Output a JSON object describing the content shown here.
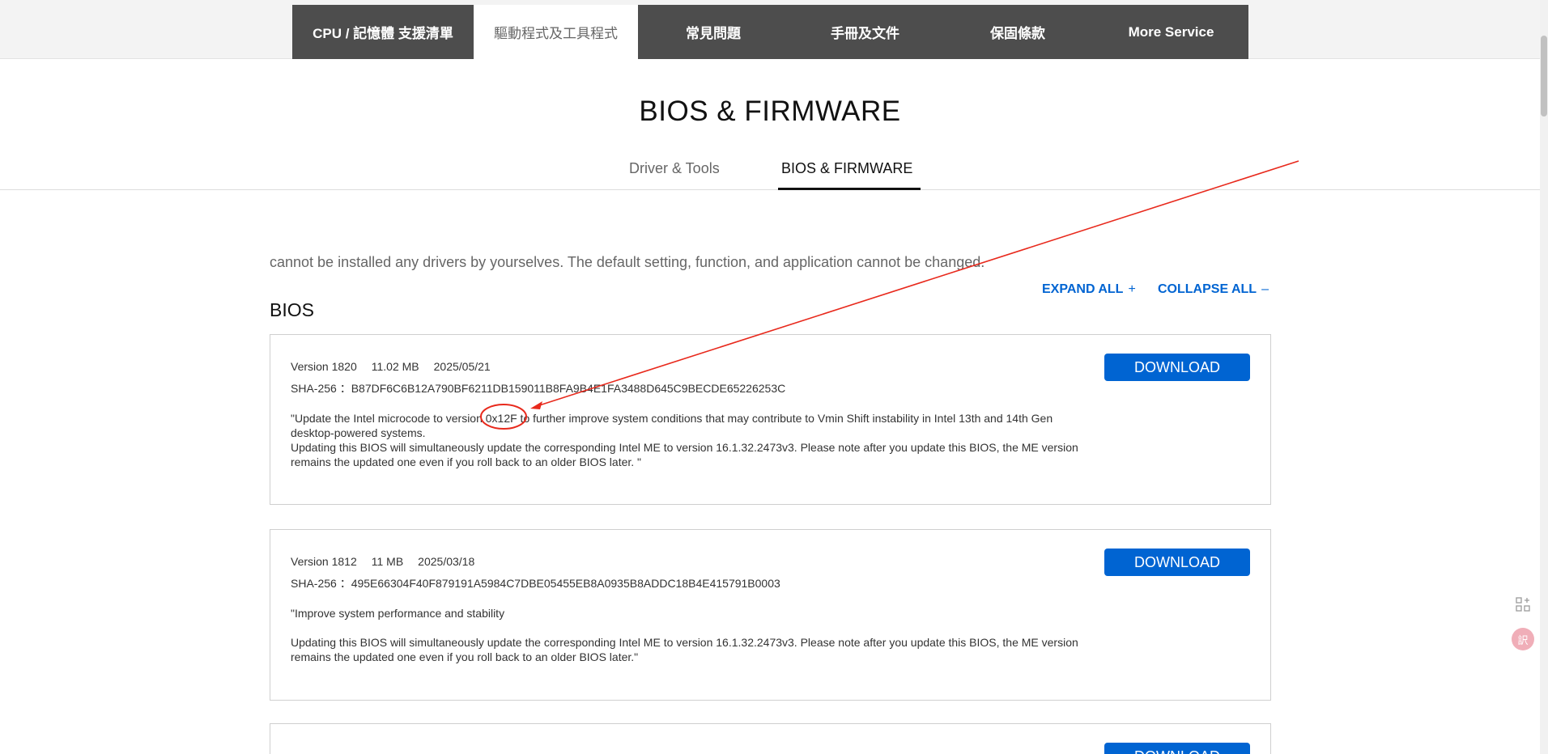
{
  "top_nav": {
    "tabs": [
      {
        "label": "CPU / 記憶體 支援清單",
        "active": false
      },
      {
        "label": "驅動程式及工具程式",
        "active": true
      },
      {
        "label": "常見問題",
        "active": false
      },
      {
        "label": "手冊及文件",
        "active": false
      },
      {
        "label": "保固條款",
        "active": false
      },
      {
        "label": "More Service",
        "active": false
      }
    ]
  },
  "page": {
    "title": "BIOS & FIRMWARE",
    "subtabs": [
      {
        "label": "Driver & Tools",
        "active": false
      },
      {
        "label": "BIOS & FIRMWARE",
        "active": true
      }
    ],
    "note": "cannot be installed any drivers by yourselves. The default setting, function, and application cannot be changed.",
    "expand_all": "EXPAND ALL",
    "collapse_all": "COLLAPSE ALL",
    "expand_symbol": "+",
    "collapse_symbol": "–",
    "section_title": "BIOS"
  },
  "bios_entries": [
    {
      "version": "Version 1820",
      "size": "11.02 MB",
      "date": "2025/05/21",
      "sha": "SHA-256 ：B87DF6C6B12A790BF6211DB159011B8FA9B4E1FA3488D645C9BECDE65226253C",
      "desc_lines": [
        "\"Update the Intel microcode to version 0x12F to further improve system conditions that may contribute to Vmin Shift instability in Intel 13th and 14th Gen desktop-powered systems.",
        "Updating this BIOS will simultaneously update the corresponding Intel ME to version 16.1.32.2473v3. Please note after you update this BIOS, the ME version remains the updated one even if you roll back to an older BIOS later. \""
      ],
      "button": "DOWNLOAD"
    },
    {
      "version": "Version 1812",
      "size": "11 MB",
      "date": "2025/03/18",
      "sha": "SHA-256 ：495E66304F40F879191A5984C7DBE05455EB8A0935B8ADDC18B4E415791B0003",
      "desc_lines": [
        "\"Improve system performance and stability",
        "Updating this BIOS will simultaneously update the corresponding Intel ME to version 16.1.32.2473v3. Please note after you update this BIOS, the ME version remains the updated one even if you roll back to an older BIOS later.\""
      ],
      "button": "DOWNLOAD"
    },
    {
      "button": "DOWNLOAD"
    }
  ],
  "floating": {
    "grid_icon": "apps-grid-icon",
    "lang_icon_text": "訳"
  },
  "colors": {
    "accent": "#0064d2",
    "nav_bg": "#4d4d4d",
    "annotation": "#e8291c"
  }
}
